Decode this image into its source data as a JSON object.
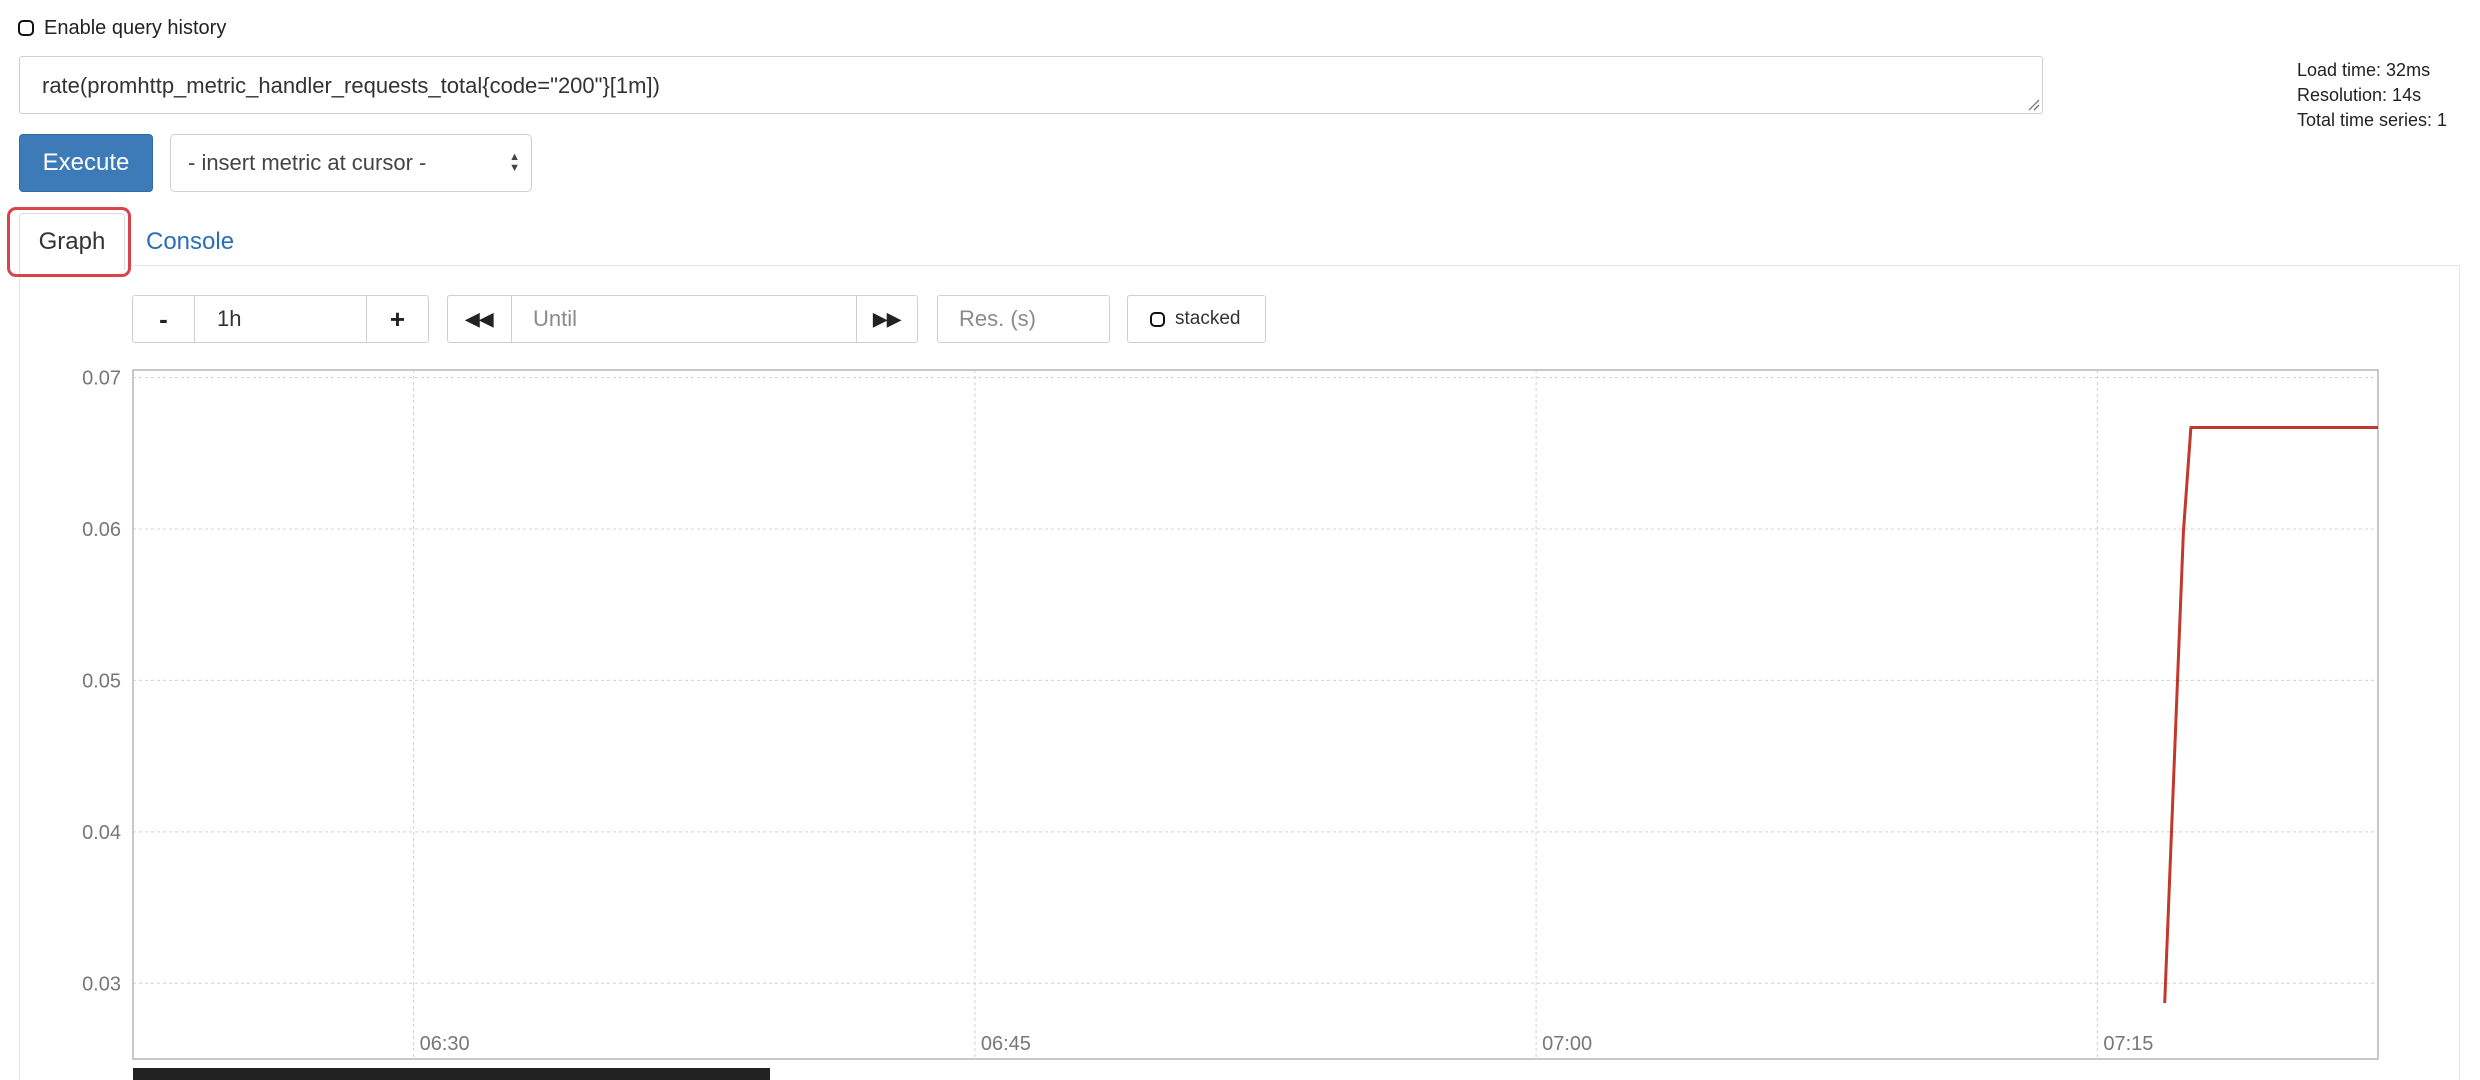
{
  "query_history": {
    "label": "Enable query history",
    "checked": false
  },
  "expression": {
    "value": "rate(promhttp_metric_handler_requests_total{code=\"200\"}[1m])"
  },
  "stats": {
    "load_time": "Load time: 32ms",
    "resolution": "Resolution: 14s",
    "total_series": "Total time series: 1"
  },
  "execute_label": "Execute",
  "metric_select": {
    "selected": "- insert metric at cursor -"
  },
  "tabs": [
    {
      "label": "Graph",
      "active": true,
      "highlighted": true
    },
    {
      "label": "Console",
      "active": false
    }
  ],
  "graph_controls": {
    "range_minus": "-",
    "range_value": "1h",
    "range_plus": "+",
    "until_placeholder": "Until",
    "res_placeholder": "Res. (s)",
    "stacked_label": "stacked"
  },
  "colors": {
    "accent": "#3d7ab8",
    "series": "#c0392b",
    "highlight": "#d9434b",
    "link": "#2a6fb6"
  },
  "chart_data": {
    "type": "line",
    "title": "",
    "xlabel": "",
    "ylabel": "",
    "x_ticks": [
      "06:30",
      "06:45",
      "07:00",
      "07:15"
    ],
    "y_ticks": [
      0.07,
      0.06,
      0.05,
      0.04,
      0.03
    ],
    "xlim_minutes": [
      "06:22.5",
      "07:22.5"
    ],
    "ylim": [
      0.025,
      0.0705
    ],
    "grid": true,
    "series": [
      {
        "points": [
          {
            "t": "07:16.8",
            "v": 0.0287
          },
          {
            "t": "07:17.3",
            "v": 0.0598
          },
          {
            "t": "07:17.5",
            "v": 0.0667
          },
          {
            "t": "07:22.5",
            "v": 0.0667
          }
        ]
      }
    ]
  }
}
